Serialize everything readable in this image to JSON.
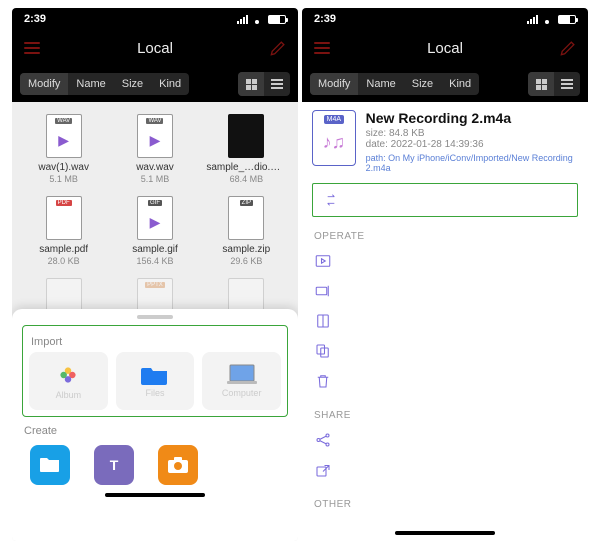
{
  "left": {
    "status_time": "2:39",
    "header_title": "Local",
    "sort_tabs": {
      "modify": "Modify",
      "name": "Name",
      "size": "Size",
      "kind": "Kind"
    },
    "files": [
      {
        "tag": "WAV",
        "glyph": "▶",
        "name": "wav(1).wav",
        "size": "5.1 MB"
      },
      {
        "tag": "WAV",
        "glyph": "▶",
        "name": "wav.wav",
        "size": "5.1 MB"
      },
      {
        "tag": "",
        "glyph": "",
        "name": "sample_…dio.mov",
        "size": "68.4 MB",
        "dark": true
      },
      {
        "tag": "PDF",
        "glyph": "",
        "name": "sample.pdf",
        "size": "28.0 KB"
      },
      {
        "tag": "GIF",
        "glyph": "▶",
        "name": "sample.gif",
        "size": "156.4 KB"
      },
      {
        "tag": "ZIP",
        "glyph": "",
        "name": "sample.zip",
        "size": "29.6 KB"
      },
      {
        "tag": "",
        "glyph": "",
        "name": "",
        "size": ""
      },
      {
        "tag": "PPTX",
        "glyph": "",
        "name": "",
        "size": ""
      },
      {
        "tag": "",
        "glyph": "",
        "name": "",
        "size": ""
      }
    ],
    "sheet": {
      "import_label": "Import",
      "import_items": {
        "album": "Album",
        "files": "Files",
        "computer": "Computer"
      },
      "create_label": "Create"
    }
  },
  "right": {
    "status_time": "2:39",
    "header_title": "Local",
    "sort_tabs": {
      "modify": "Modify",
      "name": "Name",
      "size": "Size",
      "kind": "Kind"
    },
    "file": {
      "tag": "M4A",
      "name": "New Recording 2.m4a",
      "size_label": "size: 84.8 KB",
      "date_label": "date: 2022-01-28 14:39:36",
      "path_label": "path: On My iPhone/iConv/Imported/New Recording 2.m4a"
    },
    "sections": {
      "operate": "OPERATE",
      "share": "SHARE",
      "other": "OTHER"
    }
  }
}
